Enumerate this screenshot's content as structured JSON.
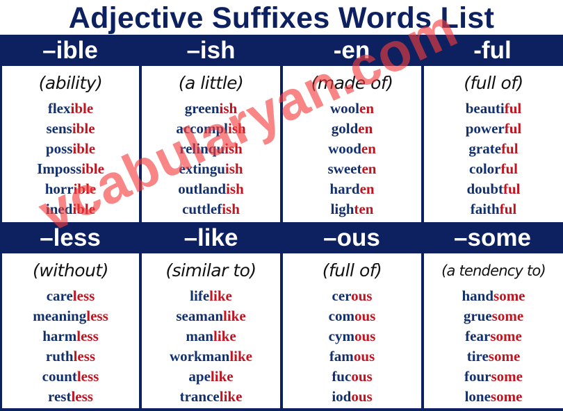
{
  "title": "Adjective Suffixes Words List",
  "colors": {
    "navy": "#0d2161",
    "stem_text": "#13306e",
    "suffix_text": "#c01420",
    "watermark": "#f53c3c"
  },
  "groups": [
    {
      "suffix": "–ible",
      "meaning": "(ability)",
      "words": [
        {
          "stem": "flex",
          "suffix": "ible"
        },
        {
          "stem": "sens",
          "suffix": "ible"
        },
        {
          "stem": "poss",
          "suffix": "ible"
        },
        {
          "stem": "Imposs",
          "suffix": "ible"
        },
        {
          "stem": "horr",
          "suffix": "ible"
        },
        {
          "stem": "ined",
          "suffix": "ible"
        }
      ]
    },
    {
      "suffix": "–ish",
      "meaning": "(a little)",
      "words": [
        {
          "stem": "green",
          "suffix": "ish"
        },
        {
          "stem": "accompl",
          "suffix": "ish"
        },
        {
          "stem": "relinqu",
          "suffix": "ish"
        },
        {
          "stem": "extingu",
          "suffix": "ish"
        },
        {
          "stem": "outland",
          "suffix": "ish"
        },
        {
          "stem": "cuttlef",
          "suffix": "ish"
        }
      ]
    },
    {
      "suffix": "-en",
      "meaning": "(made of)",
      "words": [
        {
          "stem": "wool",
          "suffix": "en"
        },
        {
          "stem": "gold",
          "suffix": "en"
        },
        {
          "stem": "wood",
          "suffix": "en"
        },
        {
          "stem": "sweet",
          "suffix": "en"
        },
        {
          "stem": "hard",
          "suffix": "en"
        },
        {
          "stem": "ligh",
          "suffix": "ten"
        }
      ]
    },
    {
      "suffix": "-ful",
      "meaning": "(full of)",
      "words": [
        {
          "stem": "beauti",
          "suffix": "ful"
        },
        {
          "stem": "power",
          "suffix": "ful"
        },
        {
          "stem": "grate",
          "suffix": "ful"
        },
        {
          "stem": "color",
          "suffix": "ful"
        },
        {
          "stem": "doubt",
          "suffix": "ful"
        },
        {
          "stem": "faith",
          "suffix": "ful"
        }
      ]
    },
    {
      "suffix": "–less",
      "meaning": "(without)",
      "words": [
        {
          "stem": "care",
          "suffix": "less"
        },
        {
          "stem": "meaning",
          "suffix": "less"
        },
        {
          "stem": "harm",
          "suffix": "less"
        },
        {
          "stem": "ruth",
          "suffix": "less"
        },
        {
          "stem": "count",
          "suffix": "less"
        },
        {
          "stem": "rest",
          "suffix": "less"
        }
      ]
    },
    {
      "suffix": "–like",
      "meaning": "(similar to)",
      "words": [
        {
          "stem": "life",
          "suffix": "like"
        },
        {
          "stem": "seaman",
          "suffix": "like"
        },
        {
          "stem": "man",
          "suffix": "like"
        },
        {
          "stem": "workman",
          "suffix": "like"
        },
        {
          "stem": "ape",
          "suffix": "like"
        },
        {
          "stem": "trance",
          "suffix": "like"
        }
      ]
    },
    {
      "suffix": "–ous",
      "meaning": "(full of)",
      "words": [
        {
          "stem": "cer",
          "suffix": "ous"
        },
        {
          "stem": "com",
          "suffix": "ous"
        },
        {
          "stem": "cym",
          "suffix": "ous"
        },
        {
          "stem": "fam",
          "suffix": "ous"
        },
        {
          "stem": "fuc",
          "suffix": "ous"
        },
        {
          "stem": "iod",
          "suffix": "ous"
        }
      ]
    },
    {
      "suffix": "–some",
      "meaning": "(a tendency to)",
      "words": [
        {
          "stem": "hand",
          "suffix": "some"
        },
        {
          "stem": "grue",
          "suffix": "some"
        },
        {
          "stem": "fear",
          "suffix": "some"
        },
        {
          "stem": "tire",
          "suffix": "some"
        },
        {
          "stem": "four",
          "suffix": "some"
        },
        {
          "stem": "lone",
          "suffix": "some"
        }
      ]
    }
  ],
  "watermark": "vcabularyan.com"
}
